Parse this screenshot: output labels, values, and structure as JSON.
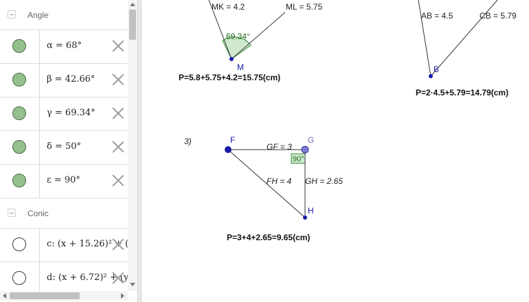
{
  "algebra": {
    "groups": [
      {
        "name": "Angle",
        "items": [
          {
            "expr": "α = 68°",
            "visible": true
          },
          {
            "expr": "β = 42.66°",
            "visible": true
          },
          {
            "expr": "γ = 69.34°",
            "visible": true
          },
          {
            "expr": "δ = 50°",
            "visible": true
          },
          {
            "expr": "ε = 90°",
            "visible": true
          }
        ]
      },
      {
        "name": "Conic",
        "items": [
          {
            "expr": "c: (x + 15.26)² + (y",
            "visible": false
          },
          {
            "expr": "d: (x + 6.72)² + (y",
            "visible": false
          }
        ]
      }
    ]
  },
  "graphics": {
    "labels": {
      "mk": "MK = 4.2",
      "ml": "ML = 5.75",
      "angle_m": "69.34°",
      "point_m": "M",
      "perimeter_1": "P=5.8+5.75+4.2=15.75(cm)",
      "ab": "AB = 4.5",
      "cb": "CB = 5.79",
      "point_b": "B",
      "perimeter_2": "P=2·4.5+5.79=14.79(cm)",
      "problem_3": "3)",
      "point_f": "F",
      "point_g": "G",
      "point_h": "H",
      "gf": "GF = 3",
      "fh": "FH = 4",
      "gh": "GH = 2.65",
      "angle_g": "90°",
      "perimeter_3": "P=3+4+2.65=9.65(cm)"
    },
    "colors": {
      "point": "#1a1aa6",
      "angle_fill": "#cfe8cf",
      "angle_stroke": "#2e8b2e",
      "angle_text": "#1f6b1f",
      "free_point": "#7a7ad6"
    }
  }
}
